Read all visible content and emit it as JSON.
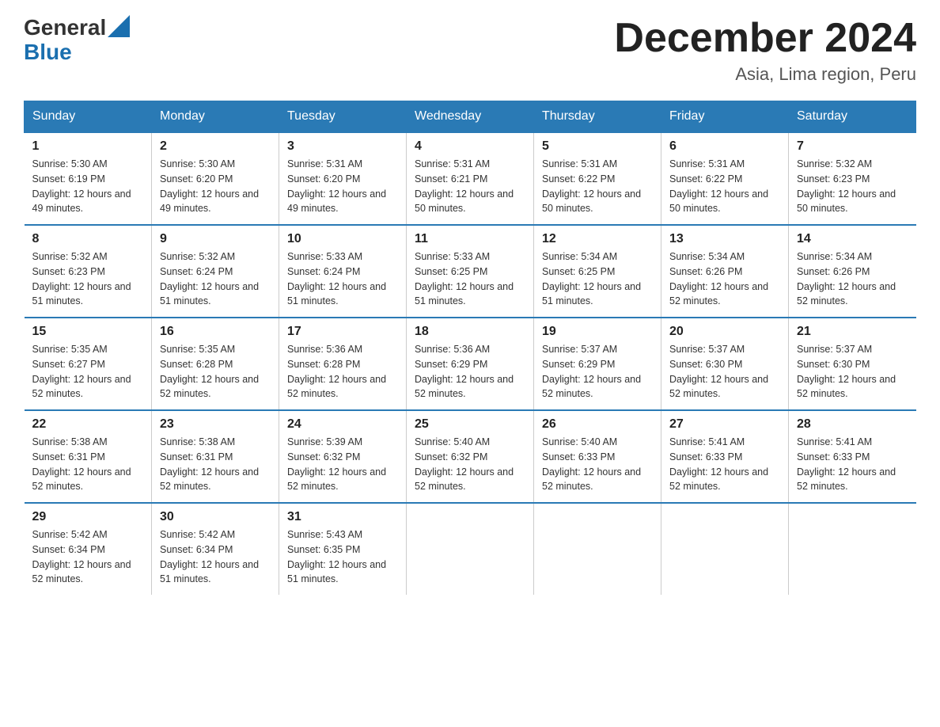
{
  "header": {
    "logo_general": "General",
    "logo_blue": "Blue",
    "month_title": "December 2024",
    "subtitle": "Asia, Lima region, Peru"
  },
  "days_of_week": [
    "Sunday",
    "Monday",
    "Tuesday",
    "Wednesday",
    "Thursday",
    "Friday",
    "Saturday"
  ],
  "weeks": [
    [
      {
        "day": "1",
        "sunrise": "5:30 AM",
        "sunset": "6:19 PM",
        "daylight": "12 hours and 49 minutes."
      },
      {
        "day": "2",
        "sunrise": "5:30 AM",
        "sunset": "6:20 PM",
        "daylight": "12 hours and 49 minutes."
      },
      {
        "day": "3",
        "sunrise": "5:31 AM",
        "sunset": "6:20 PM",
        "daylight": "12 hours and 49 minutes."
      },
      {
        "day": "4",
        "sunrise": "5:31 AM",
        "sunset": "6:21 PM",
        "daylight": "12 hours and 50 minutes."
      },
      {
        "day": "5",
        "sunrise": "5:31 AM",
        "sunset": "6:22 PM",
        "daylight": "12 hours and 50 minutes."
      },
      {
        "day": "6",
        "sunrise": "5:31 AM",
        "sunset": "6:22 PM",
        "daylight": "12 hours and 50 minutes."
      },
      {
        "day": "7",
        "sunrise": "5:32 AM",
        "sunset": "6:23 PM",
        "daylight": "12 hours and 50 minutes."
      }
    ],
    [
      {
        "day": "8",
        "sunrise": "5:32 AM",
        "sunset": "6:23 PM",
        "daylight": "12 hours and 51 minutes."
      },
      {
        "day": "9",
        "sunrise": "5:32 AM",
        "sunset": "6:24 PM",
        "daylight": "12 hours and 51 minutes."
      },
      {
        "day": "10",
        "sunrise": "5:33 AM",
        "sunset": "6:24 PM",
        "daylight": "12 hours and 51 minutes."
      },
      {
        "day": "11",
        "sunrise": "5:33 AM",
        "sunset": "6:25 PM",
        "daylight": "12 hours and 51 minutes."
      },
      {
        "day": "12",
        "sunrise": "5:34 AM",
        "sunset": "6:25 PM",
        "daylight": "12 hours and 51 minutes."
      },
      {
        "day": "13",
        "sunrise": "5:34 AM",
        "sunset": "6:26 PM",
        "daylight": "12 hours and 52 minutes."
      },
      {
        "day": "14",
        "sunrise": "5:34 AM",
        "sunset": "6:26 PM",
        "daylight": "12 hours and 52 minutes."
      }
    ],
    [
      {
        "day": "15",
        "sunrise": "5:35 AM",
        "sunset": "6:27 PM",
        "daylight": "12 hours and 52 minutes."
      },
      {
        "day": "16",
        "sunrise": "5:35 AM",
        "sunset": "6:28 PM",
        "daylight": "12 hours and 52 minutes."
      },
      {
        "day": "17",
        "sunrise": "5:36 AM",
        "sunset": "6:28 PM",
        "daylight": "12 hours and 52 minutes."
      },
      {
        "day": "18",
        "sunrise": "5:36 AM",
        "sunset": "6:29 PM",
        "daylight": "12 hours and 52 minutes."
      },
      {
        "day": "19",
        "sunrise": "5:37 AM",
        "sunset": "6:29 PM",
        "daylight": "12 hours and 52 minutes."
      },
      {
        "day": "20",
        "sunrise": "5:37 AM",
        "sunset": "6:30 PM",
        "daylight": "12 hours and 52 minutes."
      },
      {
        "day": "21",
        "sunrise": "5:37 AM",
        "sunset": "6:30 PM",
        "daylight": "12 hours and 52 minutes."
      }
    ],
    [
      {
        "day": "22",
        "sunrise": "5:38 AM",
        "sunset": "6:31 PM",
        "daylight": "12 hours and 52 minutes."
      },
      {
        "day": "23",
        "sunrise": "5:38 AM",
        "sunset": "6:31 PM",
        "daylight": "12 hours and 52 minutes."
      },
      {
        "day": "24",
        "sunrise": "5:39 AM",
        "sunset": "6:32 PM",
        "daylight": "12 hours and 52 minutes."
      },
      {
        "day": "25",
        "sunrise": "5:40 AM",
        "sunset": "6:32 PM",
        "daylight": "12 hours and 52 minutes."
      },
      {
        "day": "26",
        "sunrise": "5:40 AM",
        "sunset": "6:33 PM",
        "daylight": "12 hours and 52 minutes."
      },
      {
        "day": "27",
        "sunrise": "5:41 AM",
        "sunset": "6:33 PM",
        "daylight": "12 hours and 52 minutes."
      },
      {
        "day": "28",
        "sunrise": "5:41 AM",
        "sunset": "6:33 PM",
        "daylight": "12 hours and 52 minutes."
      }
    ],
    [
      {
        "day": "29",
        "sunrise": "5:42 AM",
        "sunset": "6:34 PM",
        "daylight": "12 hours and 52 minutes."
      },
      {
        "day": "30",
        "sunrise": "5:42 AM",
        "sunset": "6:34 PM",
        "daylight": "12 hours and 51 minutes."
      },
      {
        "day": "31",
        "sunrise": "5:43 AM",
        "sunset": "6:35 PM",
        "daylight": "12 hours and 51 minutes."
      },
      null,
      null,
      null,
      null
    ]
  ]
}
